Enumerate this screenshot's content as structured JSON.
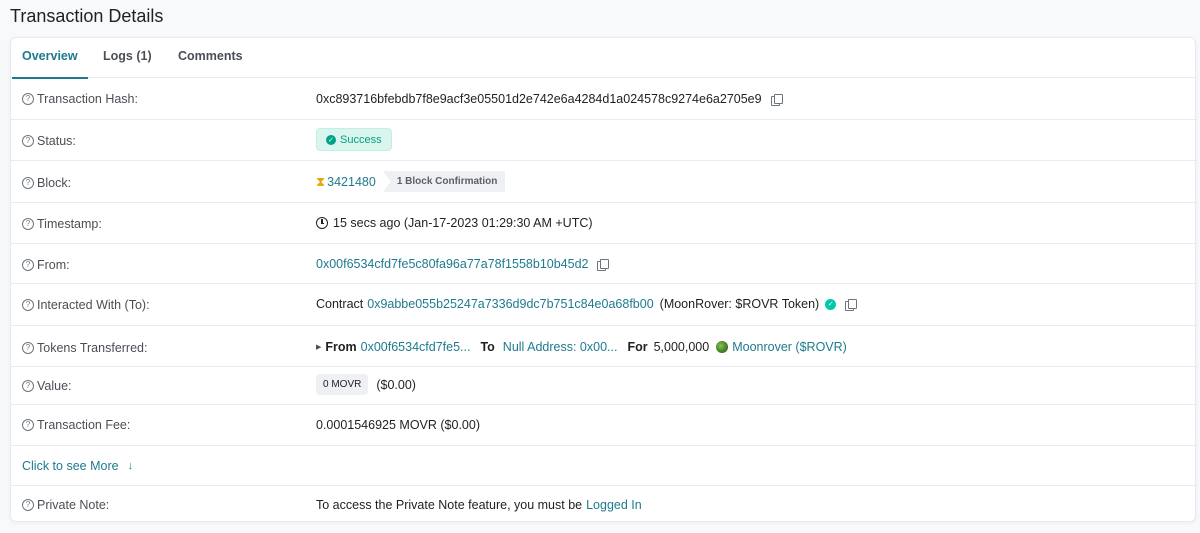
{
  "page_title": "Transaction Details",
  "tabs": [
    {
      "label": "Overview"
    },
    {
      "label": "Logs (1)"
    },
    {
      "label": "Comments"
    }
  ],
  "rows": {
    "tx_hash": {
      "label": "Transaction Hash:",
      "value": "0xc893716bfebdb7f8e9acf3e05501d2e742e6a4284d1a024578c9274e6a2705e9"
    },
    "status": {
      "label": "Status:",
      "value": "Success"
    },
    "block": {
      "label": "Block:",
      "value": "3421480",
      "confirmations": "1 Block Confirmation"
    },
    "timestamp": {
      "label": "Timestamp:",
      "value": "15 secs ago (Jan-17-2023 01:29:30 AM +UTC)"
    },
    "from": {
      "label": "From:",
      "value": "0x00f6534cfd7fe5c80fa96a77a78f1558b10b45d2"
    },
    "interacted": {
      "label": "Interacted With (To):",
      "prefix": "Contract",
      "address": "0x9abbe055b25247a7336d9dc7b751c84e0a68fb00",
      "name": "(MoonRover: $ROVR Token)"
    },
    "tokens": {
      "label": "Tokens Transferred:",
      "from_label": "From",
      "from_value": "0x00f6534cfd7fe5...",
      "to_label": "To",
      "to_value": "Null Address: 0x00...",
      "for_label": "For",
      "amount": "5,000,000",
      "token": "Moonrover ($ROVR)"
    },
    "value": {
      "label": "Value:",
      "badge": "0 MOVR",
      "usd": "($0.00)"
    },
    "fee": {
      "label": "Transaction Fee:",
      "value": "0.0001546925 MOVR ($0.00)"
    },
    "see_more": "Click to see More",
    "private_note": {
      "label": "Private Note:",
      "text": "To access the Private Note feature, you must be",
      "link": "Logged In"
    }
  },
  "colors": {
    "accent": "#1e7b8e",
    "success": "#00a186",
    "warning": "#e0a800"
  },
  "icons": [
    "question-circle-icon",
    "copy-icon",
    "check-circle-icon",
    "hourglass-icon",
    "clock-icon",
    "verified-icon",
    "caret-right-icon",
    "token-logo-icon",
    "arrow-down-icon"
  ]
}
